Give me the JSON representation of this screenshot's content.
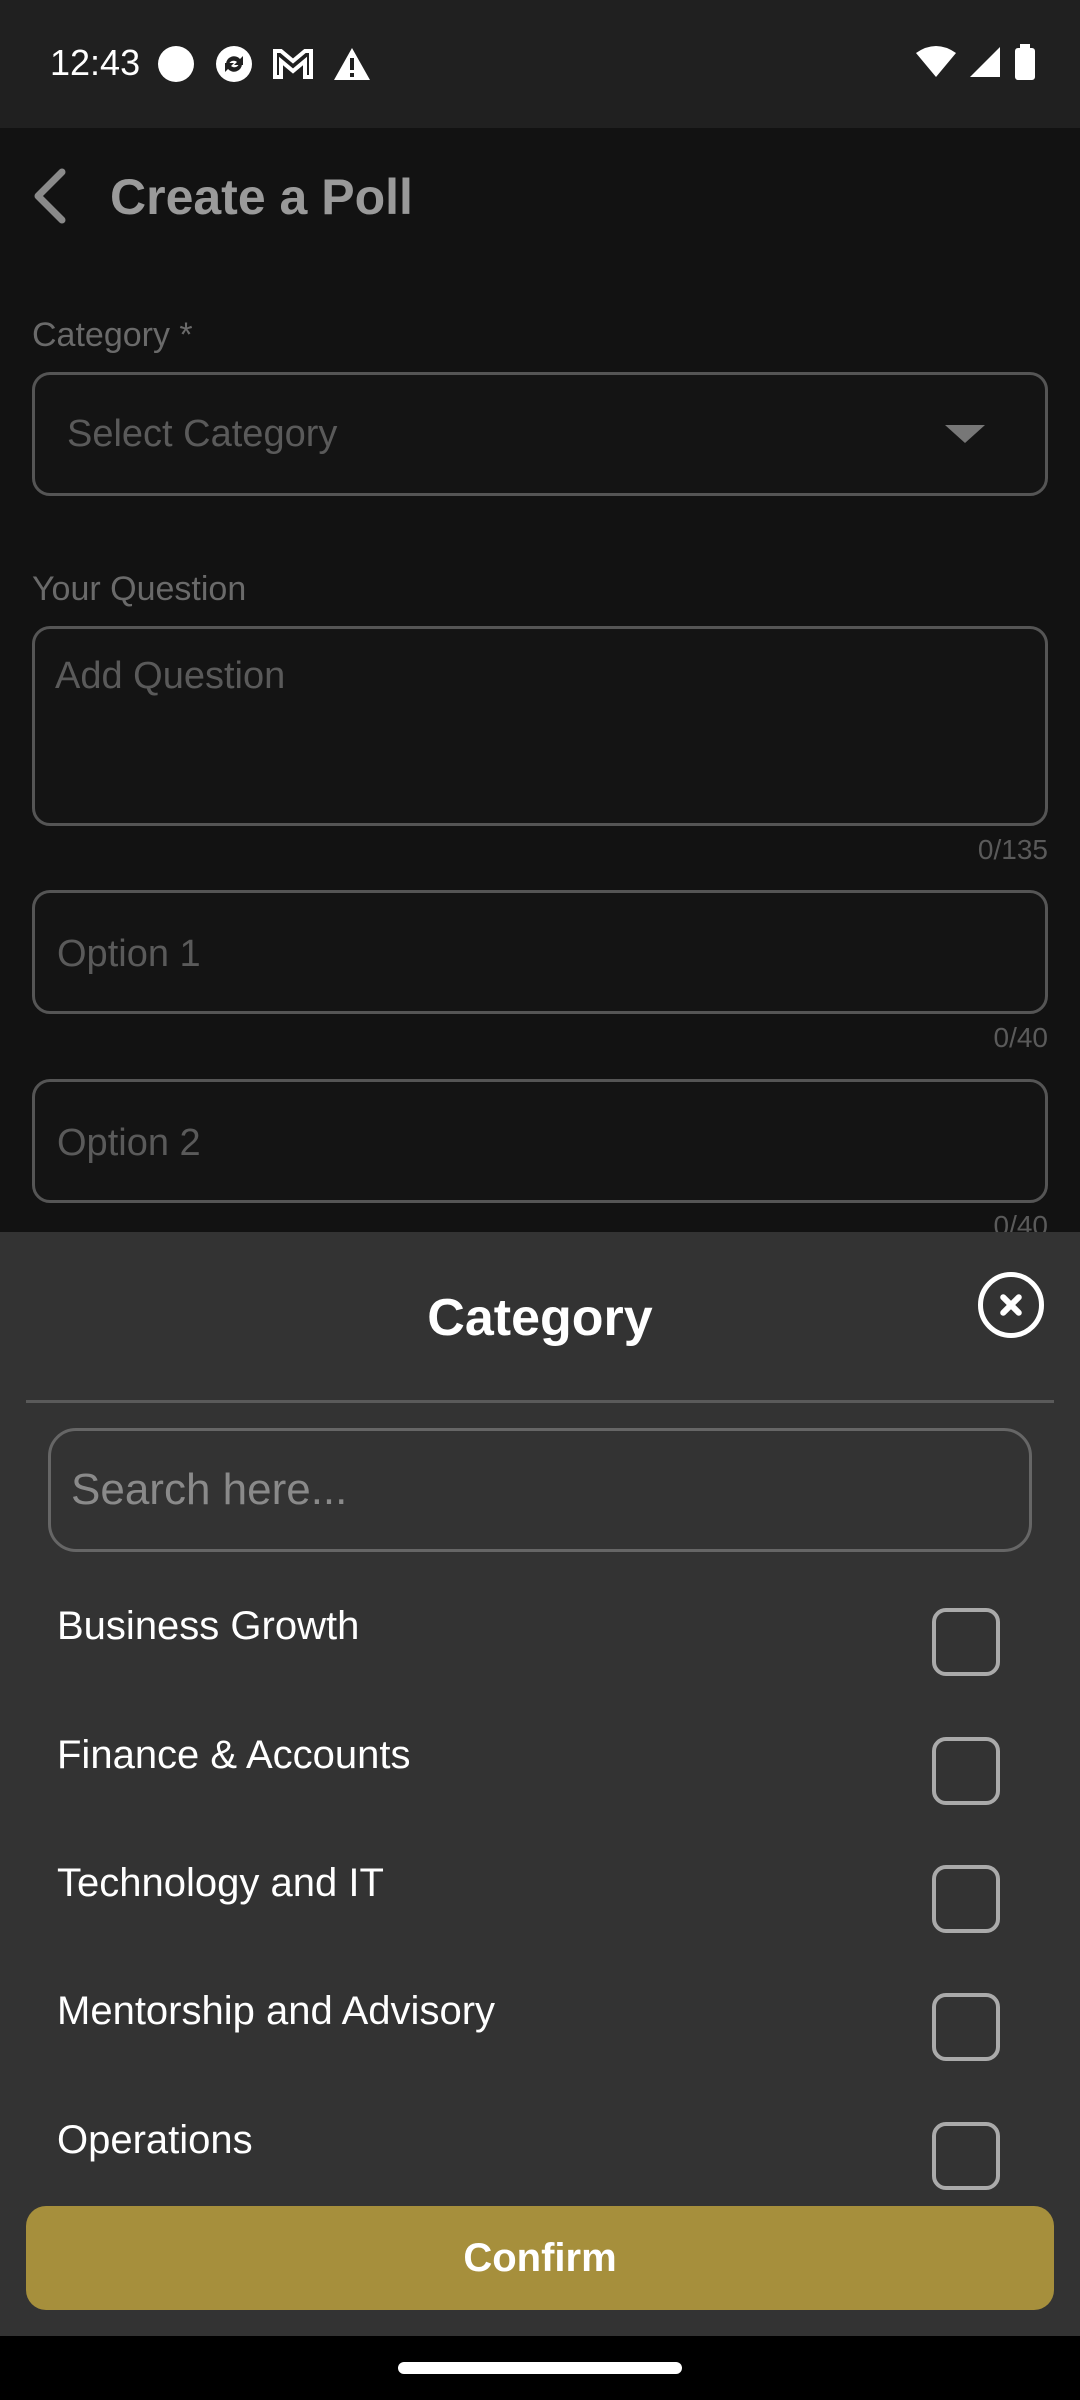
{
  "status_bar": {
    "time": "12:43",
    "left_icons": [
      "circle-icon",
      "sync-icon",
      "gmail-icon",
      "warning-icon"
    ],
    "right_icons": [
      "wifi-icon",
      "signal-icon",
      "battery-icon"
    ]
  },
  "page": {
    "title": "Create a Poll",
    "category_label": "Category *",
    "category_placeholder": "Select Category",
    "question_label": "Your Question",
    "question_placeholder": "Add Question",
    "question_counter": "0/135",
    "option1_placeholder": "Option 1",
    "option1_counter": "0/40",
    "option2_placeholder": "Option 2",
    "option2_counter": "0/40"
  },
  "sheet": {
    "title": "Category",
    "search_placeholder": "Search here...",
    "items": [
      {
        "label": "Business Growth",
        "checked": false
      },
      {
        "label": "Finance & Accounts",
        "checked": false
      },
      {
        "label": "Technology and IT",
        "checked": false
      },
      {
        "label": "Mentorship and Advisory",
        "checked": false
      },
      {
        "label": "Operations",
        "checked": false
      }
    ],
    "confirm_label": "Confirm"
  },
  "colors": {
    "sheet_bg": "#333333",
    "accent": "#a68f3c",
    "page_bg": "#121212"
  }
}
